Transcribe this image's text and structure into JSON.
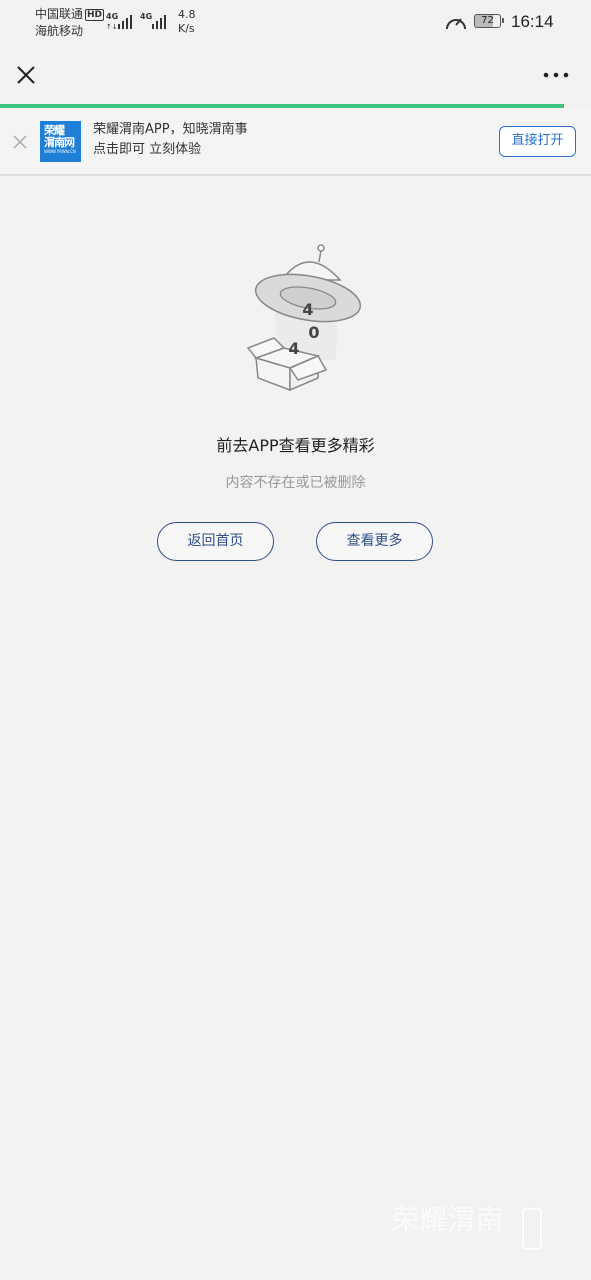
{
  "status_bar": {
    "carrier_1": "中国联通",
    "hd_label": "HD",
    "carrier_2": "海航移动",
    "signal_1_label": "4G",
    "signal_2_label": "4G",
    "net_speed_value": "4.8",
    "net_speed_unit": "K/s",
    "battery_level": "72",
    "time": "16:14"
  },
  "nav": {
    "close_icon": "close-icon",
    "more_icon": "more-horizontal-icon"
  },
  "banner": {
    "logo_line_1": "荣耀",
    "logo_line_2": "渭南网",
    "logo_sub": "WWW.YRWN.CN",
    "line_1": "荣耀渭南APP，知晓渭南事",
    "line_2": "点击即可 立刻体验",
    "open_label": "直接打开"
  },
  "error": {
    "illustration_digits": [
      "4",
      "0",
      "4"
    ],
    "title": "前去APP查看更多精彩",
    "subtitle": "内容不存在或已被删除",
    "home_button": "返回首页",
    "more_button": "查看更多"
  },
  "watermark": {
    "main": "荣耀渭南",
    "sub": "YRWN.CN"
  },
  "colors": {
    "progress": "#3cc47c",
    "logo_bg": "#1f7ed6",
    "open_button": "#2b6ed0",
    "outline_buttons": "#2d4f8a"
  }
}
